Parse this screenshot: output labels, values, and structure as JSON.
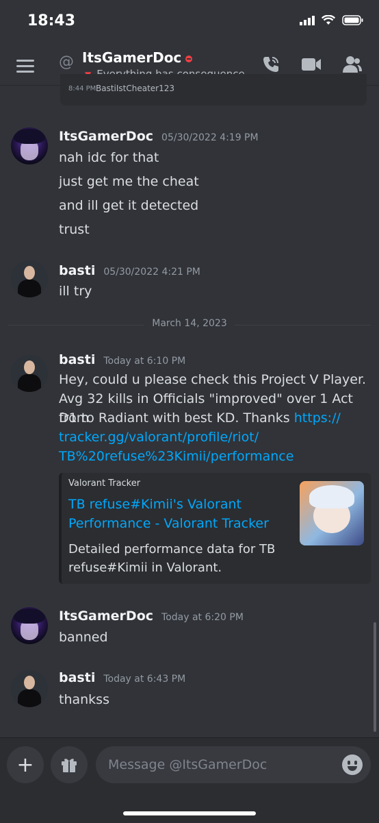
{
  "status_bar": {
    "time": "18:43"
  },
  "header": {
    "title": "ItsGamerDoc",
    "status_text": "Everything has consequence...",
    "at_symbol": "@"
  },
  "previous_embed": {
    "time": "8:44 PM",
    "user": "BastiIstCheater123"
  },
  "messages": [
    {
      "author": "ItsGamerDoc",
      "timestamp": "05/30/2022 4:19 PM",
      "lines": [
        "nah idc for that",
        "just get me the cheat",
        "and ill get it detected",
        "trust"
      ]
    },
    {
      "author": "basti",
      "timestamp": "05/30/2022 4:21 PM",
      "lines": [
        "ill try"
      ]
    },
    {
      "author": "basti",
      "timestamp": "Today at 6:10 PM",
      "lines": [
        "Hey, could u please check this Project V Player.",
        "Avg 32 kills in Officials \"improved\" over 1 Act from",
        "D1 to Radiant with best KD. Thanks"
      ],
      "link_inline": "https://",
      "link_lines": [
        "tracker.gg/valorant/profile/riot/",
        "TB%20refuse%23Kimii/performance"
      ]
    },
    {
      "author": "ItsGamerDoc",
      "timestamp": "Today at 6:20 PM",
      "lines": [
        "banned"
      ]
    },
    {
      "author": "basti",
      "timestamp": "Today at 6:43 PM",
      "lines": [
        "thankss"
      ]
    }
  ],
  "date_divider": "March 14, 2023",
  "embed": {
    "provider": "Valorant Tracker",
    "title_lines": [
      "TB refuse#Kimii's Valorant",
      "Performance - Valorant Tracker"
    ],
    "desc_lines": [
      "Detailed performance data for TB",
      "refuse#Kimii in Valorant."
    ]
  },
  "composer": {
    "placeholder": "Message @ItsGamerDoc",
    "add_label": "+"
  },
  "colors": {
    "background": "#313338",
    "link": "#00a8fc",
    "dnd": "#f23f43"
  }
}
